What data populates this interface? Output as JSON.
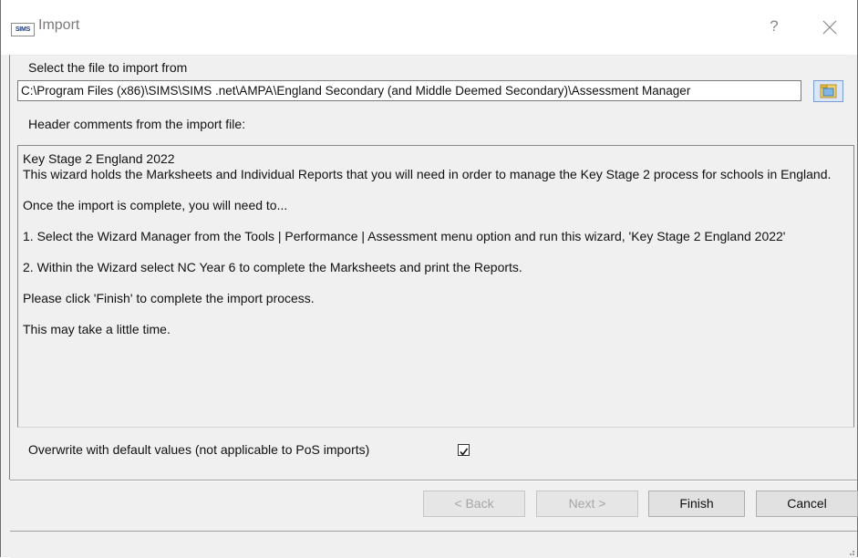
{
  "window": {
    "title": "Import",
    "app_icon_text": "SIMS",
    "help_symbol": "?",
    "close_icon": "close-icon"
  },
  "file_select": {
    "label": "Select the file to import from",
    "path_value": "C:\\Program Files (x86)\\SIMS\\SIMS .net\\AMPA\\England Secondary (and Middle Deemed Secondary)\\Assessment Manager",
    "browse_icon": "folder-browse-icon"
  },
  "header_comments": {
    "label": "Header comments from the import file:",
    "lines": [
      "Key Stage 2 England 2022",
      "This wizard holds the Marksheets and Individual Reports that you will need in order to manage the Key Stage 2 process for schools in England.",
      "Once the import is complete, you will need to...",
      "1. Select the Wizard Manager from the Tools | Performance | Assessment menu option and run this wizard, 'Key Stage 2 England 2022'",
      "2. Within the Wizard select NC Year 6 to complete the Marksheets and print the Reports.",
      "Please click 'Finish' to complete the import process.",
      "This may take a little time."
    ]
  },
  "overwrite": {
    "label": "Overwrite with default values (not applicable to PoS imports)",
    "checked": true,
    "check_mark": "✔"
  },
  "buttons": {
    "back": "< Back",
    "next": "Next >",
    "finish": "Finish",
    "cancel": "Cancel"
  },
  "colors": {
    "window_bg": "#f0f0f0",
    "titlebar_bg": "#ffffff",
    "browse_button_bg": "#dbe7f8",
    "folder_yellow": "#e8b93a"
  }
}
